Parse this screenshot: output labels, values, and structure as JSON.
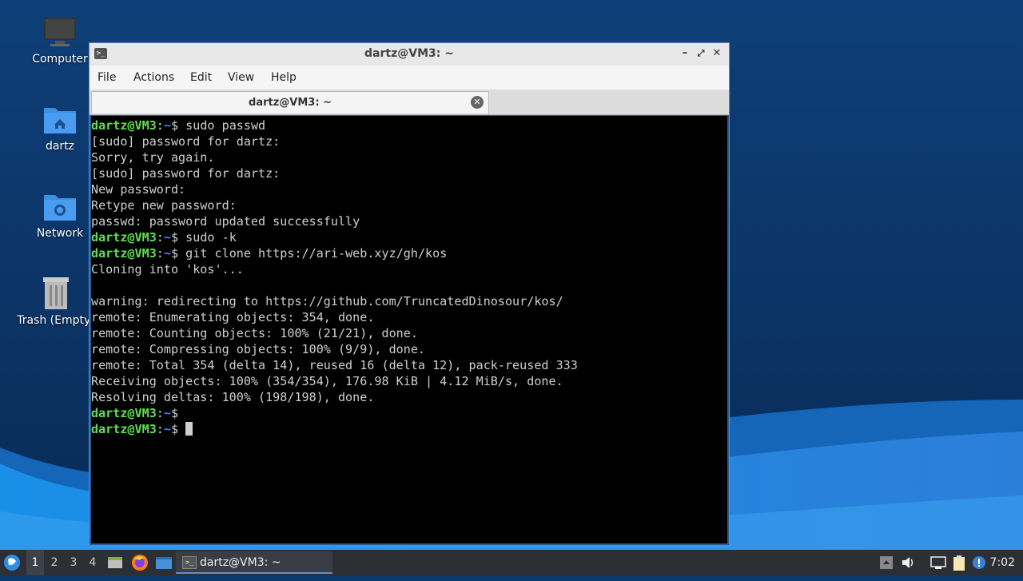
{
  "desktop": {
    "icons": [
      {
        "label": "Computer",
        "icon": "computer-icon"
      },
      {
        "label": "dartz",
        "icon": "home-folder-icon"
      },
      {
        "label": "Network",
        "icon": "network-folder-icon"
      },
      {
        "label": "Trash (Empty)",
        "icon": "trash-icon"
      }
    ]
  },
  "window": {
    "title": "dartz@VM3: ~",
    "menu": [
      "File",
      "Actions",
      "Edit",
      "View",
      "Help"
    ],
    "tab": {
      "title": "dartz@VM3: ~"
    }
  },
  "terminal": {
    "prompt_user": "dartz@VM3",
    "prompt_sep": ":",
    "prompt_dir": "~",
    "prompt_symbol": "$",
    "lines": [
      {
        "type": "cmd",
        "text": " sudo passwd"
      },
      {
        "type": "out",
        "text": "[sudo] password for dartz:"
      },
      {
        "type": "out",
        "text": "Sorry, try again."
      },
      {
        "type": "out",
        "text": "[sudo] password for dartz:"
      },
      {
        "type": "out",
        "text": "New password:"
      },
      {
        "type": "out",
        "text": "Retype new password:"
      },
      {
        "type": "out",
        "text": "passwd: password updated successfully"
      },
      {
        "type": "cmd",
        "text": " sudo -k"
      },
      {
        "type": "cmd",
        "text": " git clone https://ari-web.xyz/gh/kos"
      },
      {
        "type": "out",
        "text": "Cloning into 'kos'..."
      },
      {
        "type": "out",
        "text": ""
      },
      {
        "type": "out",
        "text": "warning: redirecting to https://github.com/TruncatedDinosour/kos/"
      },
      {
        "type": "out",
        "text": "remote: Enumerating objects: 354, done."
      },
      {
        "type": "out",
        "text": "remote: Counting objects: 100% (21/21), done."
      },
      {
        "type": "out",
        "text": "remote: Compressing objects: 100% (9/9), done."
      },
      {
        "type": "out",
        "text": "remote: Total 354 (delta 14), reused 16 (delta 12), pack-reused 333"
      },
      {
        "type": "out",
        "text": "Receiving objects: 100% (354/354), 176.98 KiB | 4.12 MiB/s, done."
      },
      {
        "type": "out",
        "text": "Resolving deltas: 100% (198/198), done."
      },
      {
        "type": "cmd",
        "text": ""
      },
      {
        "type": "cursor",
        "text": " "
      }
    ]
  },
  "taskbar": {
    "workspaces": [
      "1",
      "2",
      "3",
      "4"
    ],
    "active_workspace": "1",
    "task_label": "dartz@VM3: ~",
    "clock": "7:02"
  },
  "colors": {
    "prompt_green": "#5fe14f",
    "prompt_blue": "#4f82e6",
    "terminal_bg": "#000000",
    "desktop_blue": "#0d3a6e"
  }
}
